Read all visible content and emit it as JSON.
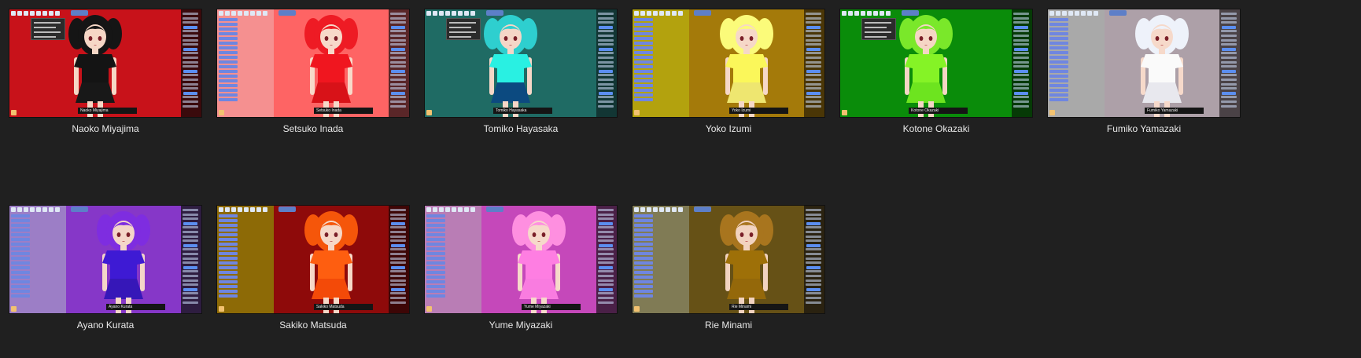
{
  "tiles": [
    {
      "name": "Naoko Miyajima",
      "stage": "#c8121a",
      "panel": "#b30f16",
      "right": "#3a0a0c",
      "hair": "#151515",
      "dress": "#141414",
      "skirt": "#181818",
      "skin": "#f6d7c6",
      "layout": "dialog"
    },
    {
      "name": "Setsuko Inada",
      "stage": "#fe6464",
      "panel": "#f59090",
      "right": "#5a2628",
      "hair": "#ee1b24",
      "dress": "#f0161f",
      "skirt": "#d81218",
      "skin": "#f7d9c9",
      "layout": "list"
    },
    {
      "name": "Tomiko Hayasaka",
      "stage": "#1f6b64",
      "panel": "#528a84",
      "right": "#123634",
      "hair": "#2ecfcf",
      "dress": "#29f0e2",
      "skirt": "#0c4a80",
      "skin": "#f5d6c7",
      "layout": "dialog"
    },
    {
      "name": "Yoko Izumi",
      "stage": "#a47a0a",
      "panel": "#b3a20e",
      "right": "#4a3606",
      "hair": "#fbfb7a",
      "dress": "#fbf75a",
      "skirt": "#eee670",
      "skin": "#f6d8c8",
      "layout": "list"
    },
    {
      "name": "Kotone Okazaki",
      "stage": "#0a8c0a",
      "panel": "#0a7a0a",
      "right": "#063a06",
      "hair": "#7ae82a",
      "dress": "#85f326",
      "skirt": "#6de41f",
      "skin": "#f5d6c5",
      "layout": "dialog"
    },
    {
      "name": "Fumiko Yamazaki",
      "stage": "#ada0a8",
      "panel": "#a9a9a9",
      "right": "#4a4246",
      "hair": "#eef2fa",
      "dress": "#fafafa",
      "skirt": "#e8e8ee",
      "skin": "#f6d9ca",
      "layout": "list"
    },
    {
      "name": "Ayano Kurata",
      "stage": "#8637c8",
      "panel": "#9c7ec6",
      "right": "#2e1d40",
      "hair": "#7e2de0",
      "dress": "#3e1ad4",
      "skirt": "#3617b8",
      "skin": "#f4d6c8",
      "layout": "list"
    },
    {
      "name": "Sakiko Matsuda",
      "stage": "#8e0a0a",
      "panel": "#8d6a06",
      "right": "#3d0606",
      "hair": "#f5560a",
      "dress": "#fe5e10",
      "skirt": "#f34a08",
      "skin": "#f6d8c7",
      "layout": "list"
    },
    {
      "name": "Yume Miyazaki",
      "stage": "#c548ba",
      "panel": "#b97db5",
      "right": "#4a2047",
      "hair": "#fe8fe0",
      "dress": "#fe7ee2",
      "skirt": "#f97ce0",
      "skin": "#f6d9ca",
      "layout": "list"
    },
    {
      "name": "Rie Minami",
      "stage": "#665116",
      "panel": "#807b55",
      "right": "#2a2210",
      "hair": "#a8751e",
      "dress": "#9e7008",
      "skirt": "#94680a",
      "skin": "#f2d3c0",
      "layout": "list"
    }
  ]
}
